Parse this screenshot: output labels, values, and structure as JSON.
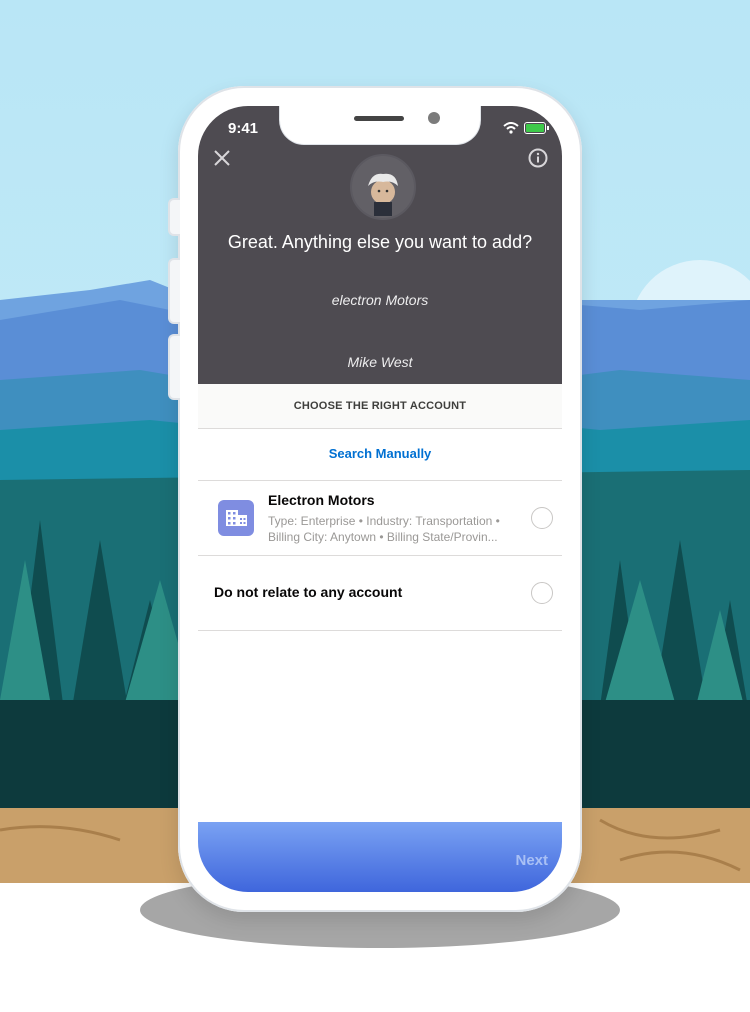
{
  "status_bar": {
    "time": "9:41"
  },
  "assistant": {
    "question": "Great. Anything else you want to add?",
    "replies": [
      "electron Motors",
      "Mike West"
    ]
  },
  "section_header": "CHOOSE THE RIGHT ACCOUNT",
  "search_manually": "Search Manually",
  "accounts": [
    {
      "name": "Electron Motors",
      "detail_line1": "Type: Enterprise • Industry: Transportation •",
      "detail_line2": "Billing City: Anytown • Billing State/Provin...",
      "icon": "building-icon"
    }
  ],
  "no_relate_label": "Do not relate to any account",
  "footer": {
    "next_label": "Next"
  },
  "colors": {
    "accent": "#0070d2",
    "footer_top": "#7aa2f3",
    "footer_bottom": "#3f66dc",
    "chat_bg": "#4e4b51"
  }
}
